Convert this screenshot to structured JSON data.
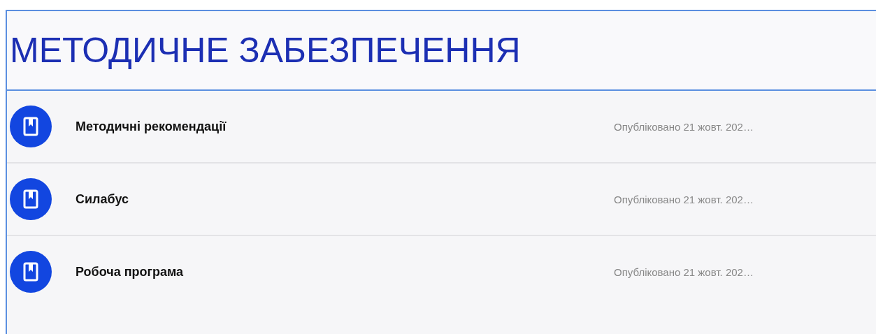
{
  "title": "МЕТОДИЧНЕ ЗАБЕЗПЕЧЕННЯ",
  "items": [
    {
      "name": "Методичні рекомендації",
      "published": "Опубліковано 21 жовт. 202…"
    },
    {
      "name": "Силабус",
      "published": "Опубліковано 21 жовт. 202…"
    },
    {
      "name": "Робоча програма",
      "published": "Опубліковано 21 жовт. 202…"
    }
  ]
}
